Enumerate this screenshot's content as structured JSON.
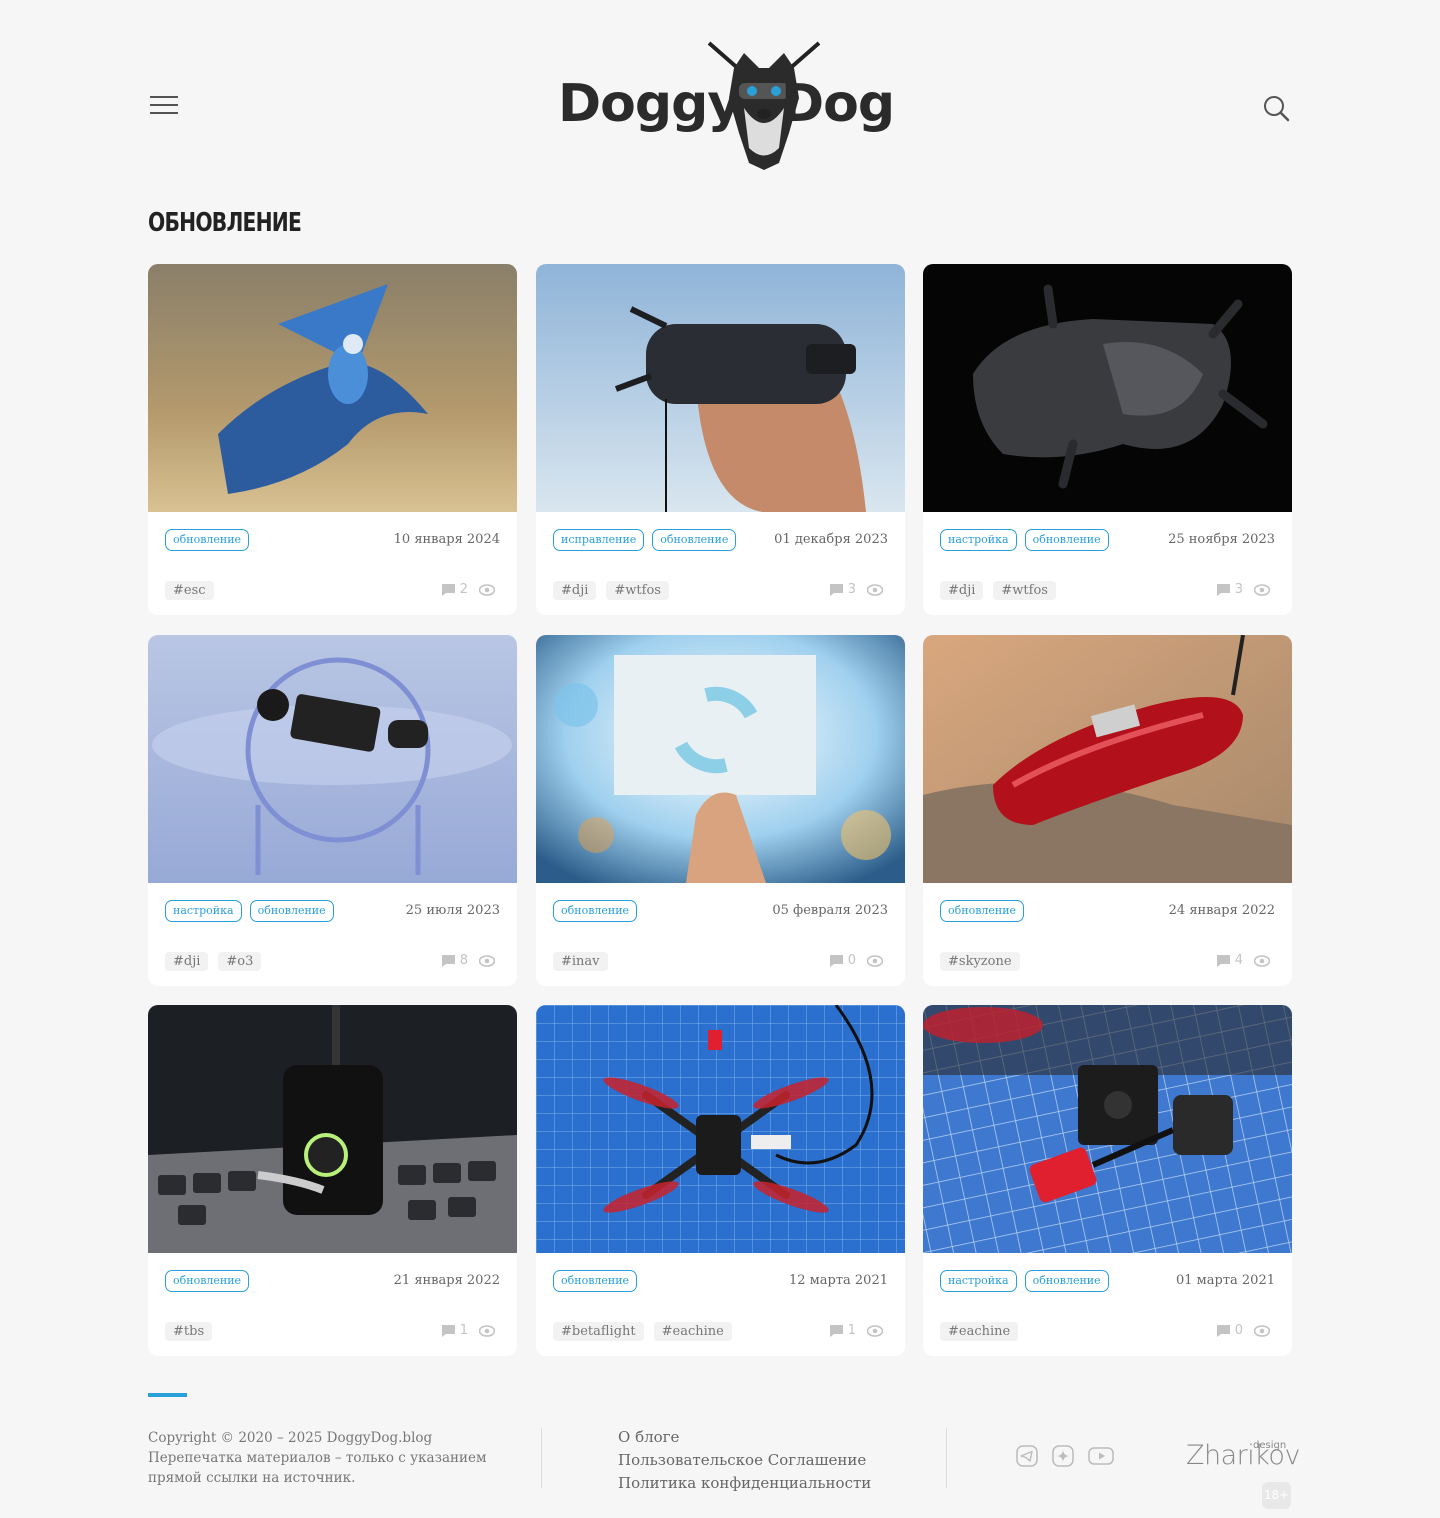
{
  "header": {
    "logo_left": "Doggy",
    "logo_right": "Dog"
  },
  "page_title": "обновление",
  "cards": [
    {
      "categories": [
        "обновление"
      ],
      "date": "10 января 2024",
      "tags": [
        "#esc"
      ],
      "comments": "2",
      "image": "blue-jay-bird"
    },
    {
      "categories": [
        "исправление",
        "обновление"
      ],
      "date": "01 декабря 2023",
      "tags": [
        "#dji",
        "#wtfos"
      ],
      "comments": "3",
      "image": "man-fpv-goggles"
    },
    {
      "categories": [
        "настройка",
        "обновление"
      ],
      "date": "25 ноября 2023",
      "tags": [
        "#dji",
        "#wtfos"
      ],
      "comments": "3",
      "image": "dji-goggles-dark"
    },
    {
      "categories": [
        "настройка",
        "обновление"
      ],
      "date": "25 июля 2023",
      "tags": [
        "#dji",
        "#o3"
      ],
      "comments": "8",
      "image": "dji-o3-air-unit"
    },
    {
      "categories": [
        "обновление"
      ],
      "date": "05 февраля 2023",
      "tags": [
        "#inav"
      ],
      "comments": "0",
      "image": "update-sign-hand"
    },
    {
      "categories": [
        "обновление"
      ],
      "date": "24 января 2022",
      "tags": [
        "#skyzone"
      ],
      "comments": "4",
      "image": "red-skyzone-goggles"
    },
    {
      "categories": [
        "обновление"
      ],
      "date": "21 января 2022",
      "tags": [
        "#tbs"
      ],
      "comments": "1",
      "image": "tbs-module-laptop"
    },
    {
      "categories": [
        "обновление"
      ],
      "date": "12 марта 2021",
      "tags": [
        "#betaflight",
        "#eachine"
      ],
      "comments": "1",
      "image": "eachine-quad-mat"
    },
    {
      "categories": [
        "настройка",
        "обновление"
      ],
      "date": "01 марта 2021",
      "tags": [
        "#eachine"
      ],
      "comments": "0",
      "image": "fpv-camera-parts"
    }
  ],
  "footer": {
    "copyright": "Copyright © 2020 – 2025 DoggyDog.blog",
    "notice": "Перепечатка материалов – только с указанием прямой ссылки на источник.",
    "links": [
      "О блоге",
      "Пользовательское Соглашение",
      "Политика конфиденциальности"
    ],
    "social_icons": [
      "telegram-icon",
      "zen-icon",
      "youtube-icon"
    ],
    "designer": "Zharikov",
    "designer_caption": "design",
    "age_rating": "18+"
  },
  "colors": {
    "accent": "#2aa0d8",
    "background": "#f6f6f7"
  }
}
